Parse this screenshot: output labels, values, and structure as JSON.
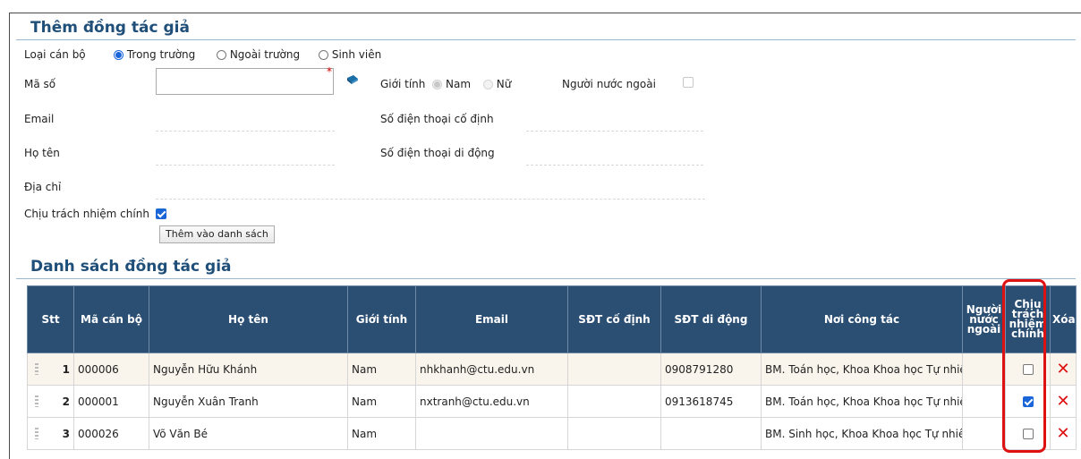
{
  "add_section": {
    "title": "Thêm đồng tác giả",
    "type_label": "Loại cán bộ",
    "type_options": [
      "Trong trường",
      "Ngoài trường",
      "Sinh viên"
    ],
    "code_label": "Mã số",
    "code_value": "",
    "required_mark": "*",
    "gender_label": "Giới tính",
    "gender_options": [
      "Nam",
      "Nữ"
    ],
    "foreigner_label": "Người nước ngoài",
    "email_label": "Email",
    "phone_fixed_label": "Số điện thoại cố định",
    "name_label": "Họ tên",
    "phone_mobile_label": "Số điện thoại di động",
    "address_label": "Địa chỉ",
    "main_resp_label": "Chịu trách nhiệm chính",
    "add_button": "Thêm vào danh sách"
  },
  "list_section": {
    "title": "Danh sách đồng tác giả",
    "headers": {
      "stt": "Stt",
      "code": "Mã cán bộ",
      "name": "Họ tên",
      "gender": "Giới tính",
      "email": "Email",
      "phone_fixed": "SĐT cố định",
      "phone_mobile": "SĐT di động",
      "workplace": "Nơi công tác",
      "foreigner": "Người nước ngoài",
      "main_resp": "Chịu trách nhiệm chính",
      "delete": "Xóa"
    },
    "rows": [
      {
        "stt": "1",
        "code": "000006",
        "name": "Nguyễn Hữu Khánh",
        "gender": "Nam",
        "email": "nhkhanh@ctu.edu.vn",
        "phone_fixed": "",
        "phone_mobile": "0908791280",
        "workplace": "BM. Toán học, Khoa Khoa học Tự nhiên",
        "main_resp": false
      },
      {
        "stt": "2",
        "code": "000001",
        "name": "Nguyễn Xuân Tranh",
        "gender": "Nam",
        "email": "nxtranh@ctu.edu.vn",
        "phone_fixed": "",
        "phone_mobile": "0913618745",
        "workplace": "BM. Toán học, Khoa Khoa học Tự nhiên",
        "main_resp": true
      },
      {
        "stt": "3",
        "code": "000026",
        "name": "Võ Văn Bé",
        "gender": "Nam",
        "email": "",
        "phone_fixed": "",
        "phone_mobile": "",
        "workplace": "BM. Sinh học, Khoa Khoa học Tự nhiên",
        "main_resp": false
      }
    ]
  },
  "colors": {
    "header_bg": "#2b4e73",
    "title": "#1f4f79",
    "highlight": "#d11111",
    "delete": "#d11111"
  }
}
